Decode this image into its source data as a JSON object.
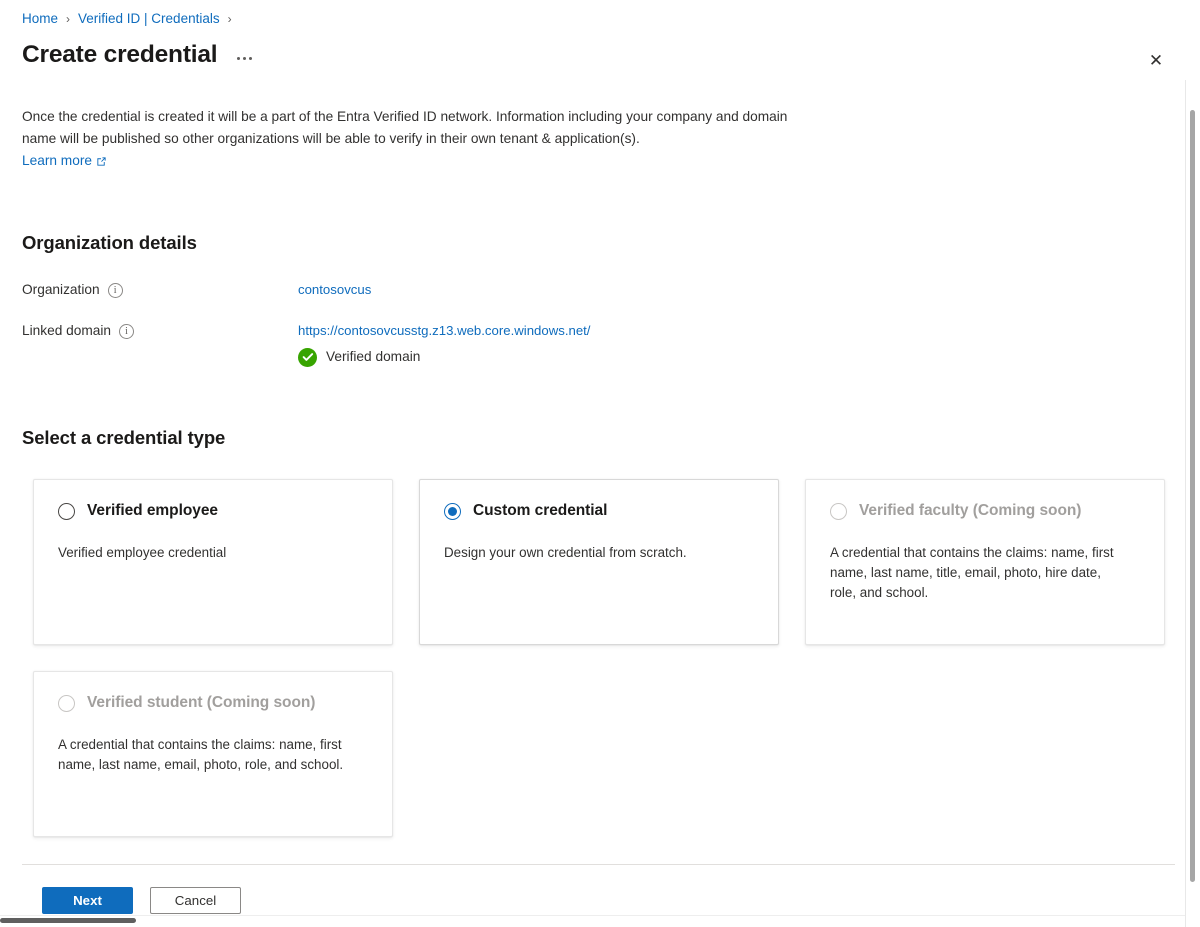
{
  "breadcrumb": {
    "items": [
      {
        "label": "Home"
      },
      {
        "label": "Verified ID | Credentials"
      }
    ],
    "separator": "›"
  },
  "header": {
    "title": "Create credential",
    "more_menu_name": "more-commands",
    "close_glyph": "✕"
  },
  "intro": {
    "paragraph": "Once the credential is created it will be a part of the Entra Verified ID network. Information including your company and domain name will be published so other organizations will be able to verify in their own tenant & application(s).",
    "learn_more_label": "Learn more"
  },
  "organization_section": {
    "heading": "Organization details",
    "fields": [
      {
        "label": "Organization",
        "value": "contosovcus",
        "is_link": true
      },
      {
        "label": "Linked domain",
        "value": "https://contosovcusstg.z13.web.core.windows.net/",
        "is_link": true,
        "status_text": "Verified domain"
      }
    ]
  },
  "credential_type_section": {
    "heading": "Select a credential type",
    "cards": [
      {
        "title": "Verified employee",
        "description": "Verified employee credential",
        "selected": false,
        "disabled": false
      },
      {
        "title": "Custom credential",
        "description": "Design your own credential from scratch.",
        "selected": true,
        "disabled": false
      },
      {
        "title": "Verified faculty (Coming soon)",
        "description": "A credential that contains the claims: name, first name, last name, title, email, photo, hire date, role, and school.",
        "selected": false,
        "disabled": true
      },
      {
        "title": "Verified student (Coming soon)",
        "description": "A credential that contains the claims: name, first name, last name, email, photo, role, and school.",
        "selected": false,
        "disabled": true
      }
    ]
  },
  "footer": {
    "next_label": "Next",
    "cancel_label": "Cancel"
  },
  "colors": {
    "link": "#0f6cbd",
    "primary_button": "#0f6cbd",
    "verified_green": "#37a400",
    "disabled_text": "#a19f9d"
  }
}
